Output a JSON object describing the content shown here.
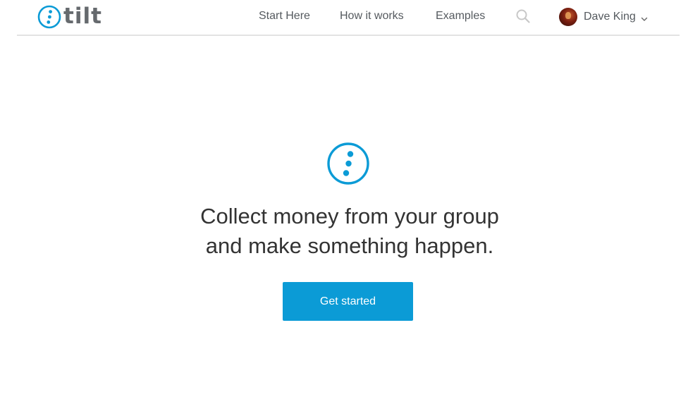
{
  "brand": {
    "name": "tilt",
    "logo_icon": "tilt-dots-icon",
    "accent_color": "#0b9bd6"
  },
  "nav": {
    "items": [
      {
        "label": "Start Here"
      },
      {
        "label": "How it works"
      },
      {
        "label": "Examples"
      }
    ],
    "search_icon": "search-icon"
  },
  "user": {
    "name": "Dave King",
    "avatar_icon": "avatar",
    "menu_icon": "chevron-down-icon"
  },
  "hero": {
    "icon": "tilt-dots-icon",
    "headline_line1": "Collect money from your group",
    "headline_line2": "and make something happen.",
    "cta_label": "Get started"
  }
}
